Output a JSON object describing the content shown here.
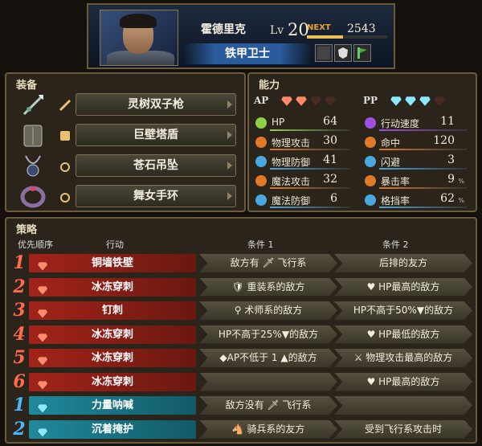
{
  "character": {
    "name": "霍德里克",
    "lv_label": "Lv",
    "level": "20",
    "next_label": "NEXT",
    "next_value": "2543",
    "next_progress": 0.45,
    "class": "铁甲卫士"
  },
  "equipment": {
    "title": "装备",
    "items": [
      {
        "name": "灵树双子枪",
        "icon": "spear-icon",
        "type": "weapon"
      },
      {
        "name": "巨壁塔盾",
        "icon": "shield-icon",
        "type": "shield"
      },
      {
        "name": "苍石吊坠",
        "icon": "pendant-icon",
        "type": "accessory"
      },
      {
        "name": "舞女手环",
        "icon": "bracelet-icon",
        "type": "accessory"
      }
    ]
  },
  "stats": {
    "title": "能力",
    "ap_label": "AP",
    "pp_label": "PP",
    "ap_gems": 2,
    "ap_gems_total": 4,
    "pp_gems": 3,
    "pp_gems_total": 4,
    "left": [
      {
        "label": "HP",
        "value": "64",
        "color": "#8fd04a",
        "icon": "heart-icon"
      },
      {
        "label": "物理攻击",
        "value": "30",
        "color": "#e07a2a",
        "icon": "sword-icon"
      },
      {
        "label": "物理防御",
        "value": "41",
        "color": "#4aa8e0",
        "icon": "armor-icon"
      },
      {
        "label": "魔法攻击",
        "value": "32",
        "color": "#e07a2a",
        "icon": "staff-icon"
      },
      {
        "label": "魔法防御",
        "value": "6",
        "color": "#4aa8e0",
        "icon": "magic-armor-icon"
      }
    ],
    "right": [
      {
        "label": "行动速度",
        "value": "11",
        "color": "#a050e0",
        "icon": "speed-icon",
        "pct": ""
      },
      {
        "label": "命中",
        "value": "120",
        "color": "#e07a2a",
        "icon": "target-icon",
        "pct": ""
      },
      {
        "label": "闪避",
        "value": "3",
        "color": "#4aa8e0",
        "icon": "evade-icon",
        "pct": ""
      },
      {
        "label": "暴击率",
        "value": "9",
        "color": "#e07a2a",
        "icon": "crit-icon",
        "pct": "%"
      },
      {
        "label": "格挡率",
        "value": "62",
        "color": "#4aa8e0",
        "icon": "block-icon",
        "pct": "%"
      }
    ]
  },
  "tactics": {
    "title": "策略",
    "headers": {
      "priority": "优先顺序",
      "action": "行动",
      "cond1": "条件 1",
      "cond2": "条件 2"
    },
    "rows": [
      {
        "num": "1",
        "kind": "ap",
        "action": "铜墙铁壁",
        "cond1": "敌方有 🗡 飞行系",
        "cond2": "后排的友方"
      },
      {
        "num": "2",
        "kind": "ap",
        "action": "冰冻穿刺",
        "cond1": "🛡 重装系的敌方",
        "cond2": "♥ HP最高的敌方"
      },
      {
        "num": "3",
        "kind": "ap",
        "action": "钉刺",
        "cond1": "⚲ 术师系的敌方",
        "cond2": "HP不高于50%▼的敌方"
      },
      {
        "num": "4",
        "kind": "ap",
        "action": "冰冻穿刺",
        "cond1": "HP不高于25%▼的敌方",
        "cond2": "♥ HP最低的敌方"
      },
      {
        "num": "5",
        "kind": "ap",
        "action": "冰冻穿刺",
        "cond1": "◆AP不低于 1 ▲的敌方",
        "cond2": "⚔ 物理攻击最高的敌方"
      },
      {
        "num": "6",
        "kind": "ap",
        "action": "冰冻穿刺",
        "cond1": "",
        "cond2": "♥ HP最高的敌方"
      },
      {
        "num": "1",
        "kind": "pp",
        "action": "力量呐喊",
        "cond1": "敌方没有 🗡 飞行系",
        "cond2": ""
      },
      {
        "num": "2",
        "kind": "pp",
        "action": "沉着掩护",
        "cond1": "🐴 骑兵系的友方",
        "cond2": "受到飞行系攻击时"
      }
    ]
  },
  "colors": {
    "ap_row": "#a3231a",
    "pp_row": "#1f8a9c",
    "ap_num": "#ff6a4a",
    "pp_num": "#4ab8ff"
  }
}
